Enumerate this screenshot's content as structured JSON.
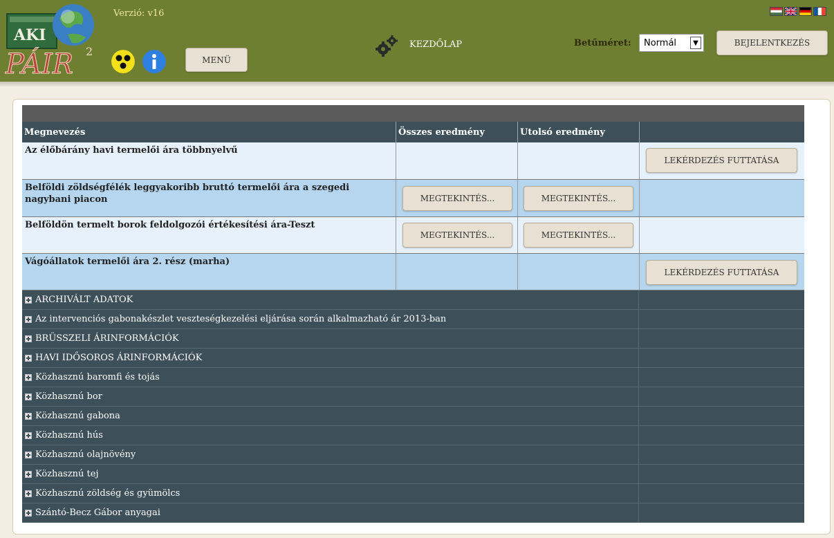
{
  "header": {
    "version": "Verzió: v16",
    "logo_text_top": "AKI",
    "logo_text_main": "PÁIR",
    "logo_superscript": "2",
    "menu_label": "MENÜ",
    "home_label": "KEZDŐLAP",
    "font_size_label": "Betűméret:",
    "font_size_value": "Normál",
    "login_label": "BEJELENTKEZÉS",
    "flags": [
      "hungarian-flag-icon",
      "uk-flag-icon",
      "german-flag-icon",
      "french-flag-icon"
    ]
  },
  "table": {
    "columns": [
      "Megnevezés",
      "Összes eredmény",
      "Utolsó eredmény",
      ""
    ],
    "rows": [
      {
        "name": "Az élőbárány havi termelői ára többnyelvű",
        "all_btn": "",
        "last_btn": "",
        "run_btn": "LEKÉRDEZÉS FUTTATÁSA"
      },
      {
        "name": "Belföldi zöldségfélék leggyakoribb bruttó termelői ára a szegedi nagybani piacon",
        "all_btn": "MEGTEKINTÉS...",
        "last_btn": "MEGTEKINTÉS...",
        "run_btn": ""
      },
      {
        "name": "Belföldön termelt borok feldolgozói értékesítési ára-Teszt",
        "all_btn": "MEGTEKINTÉS...",
        "last_btn": "MEGTEKINTÉS...",
        "run_btn": ""
      },
      {
        "name": "Vágóállatok termelői ára 2. rész (marha)",
        "all_btn": "",
        "last_btn": "",
        "run_btn": "LEKÉRDEZÉS FUTTATÁSA"
      }
    ],
    "groups": [
      "ARCHIVÁLT ADATOK",
      "Az intervenciós gabonakészlet veszteségkezelési eljárása során alkalmazható ár 2013-ban",
      "BRÜSSZELI ÁRINFORMÁCIÓK",
      "HAVI IDŐSOROS ÁRINFORMÁCIÓK",
      "Közhasznú baromfi és tojás",
      "Közhasznú bor",
      "Közhasznú gabona",
      "Közhasznú hús",
      "Közhasznú olajnövény",
      "Közhasznú tej",
      "Közhasznú zöldség és gyümölcs",
      "Szántó-Becz Gábor anyagai"
    ]
  },
  "colors": {
    "header_bg": "#6e7f32",
    "row_light": "#e6f1fb",
    "row_blue": "#b5d6ee",
    "group_bg": "#3d4f59"
  }
}
